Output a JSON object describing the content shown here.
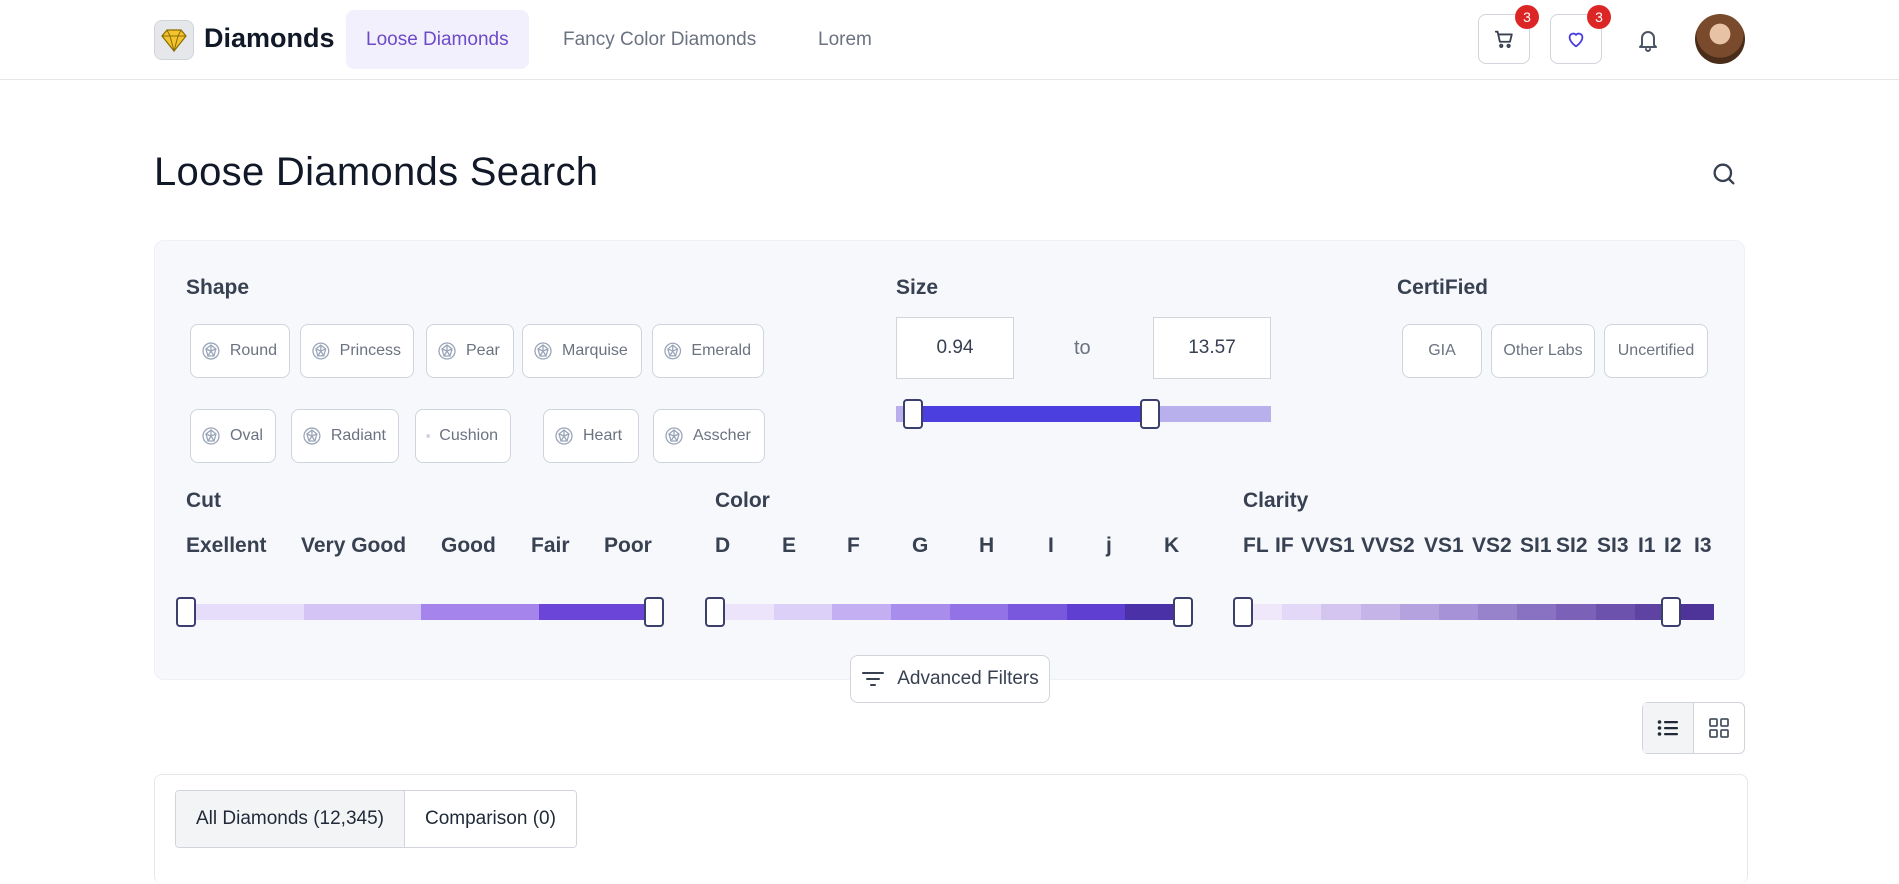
{
  "header": {
    "brand": "Diamonds",
    "nav": [
      {
        "label": "Loose Diamonds",
        "active": true
      },
      {
        "label": "Fancy Color Diamonds",
        "active": false
      },
      {
        "label": "Lorem",
        "active": false
      }
    ],
    "cart_count": "3",
    "wishlist_count": "3"
  },
  "page": {
    "title": "Loose Diamonds Search"
  },
  "filters": {
    "shape": {
      "label": "Shape",
      "options": [
        "Round",
        "Princess",
        "Pear",
        "Marquise",
        "Emerald",
        "Oval",
        "Radiant",
        "Cushion",
        "Heart",
        "Asscher"
      ]
    },
    "size": {
      "label": "Size",
      "min": "0.94",
      "max": "13.57",
      "separator": "to"
    },
    "certified": {
      "label": "CertiFied",
      "options": [
        "GIA",
        "Other Labs",
        "Uncertified"
      ]
    },
    "cut": {
      "label": "Cut",
      "grades": [
        "Exellent",
        "Very Good",
        "Good",
        "Fair",
        "Poor"
      ]
    },
    "color": {
      "label": "Color",
      "grades": [
        "D",
        "E",
        "F",
        "G",
        "H",
        "I",
        "j",
        "K"
      ]
    },
    "clarity": {
      "label": "Clarity",
      "grades": [
        "FL",
        "IF",
        "VVS1",
        "VVS2",
        "VS1",
        "VS2",
        "SI1",
        "SI2",
        "SI3",
        "I1",
        "I2",
        "I3"
      ]
    },
    "advanced_label": "Advanced Filters"
  },
  "results": {
    "tabs": [
      "All Diamonds (12,345)",
      "Comparison (0)"
    ]
  },
  "colors": {
    "accent": "#4b3fe0",
    "active_nav_bg": "#f3f0fe",
    "active_nav_text": "#6d4ac6",
    "badge": "#dc2626"
  }
}
